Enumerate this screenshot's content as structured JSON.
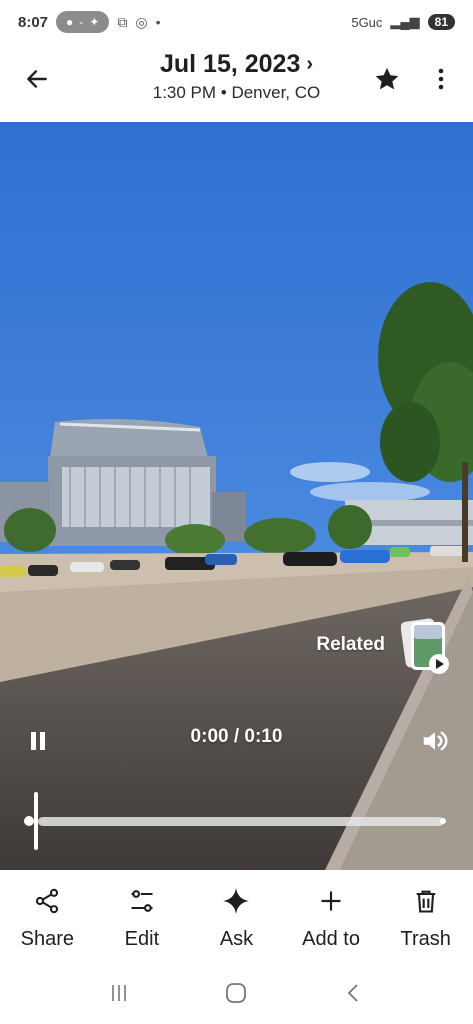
{
  "status_bar": {
    "time": "8:07",
    "network": "5Guc",
    "battery": "81"
  },
  "header": {
    "title": "Jul 15, 2023",
    "subtitle": "1:30 PM • Denver, CO"
  },
  "media": {
    "related_label": "Related",
    "current_time": "0:00",
    "duration": "0:10",
    "time_display": "0:00 / 0:10",
    "progress": 0
  },
  "actions": [
    {
      "label": "Share",
      "icon": "share-icon"
    },
    {
      "label": "Edit",
      "icon": "edit-sliders-icon"
    },
    {
      "label": "Ask",
      "icon": "sparkle-icon"
    },
    {
      "label": "Add to",
      "icon": "plus-icon"
    },
    {
      "label": "Trash",
      "icon": "trash-icon"
    }
  ],
  "colors": {
    "sky": "#3f7fd6",
    "white": "#ffffff",
    "text": "#1f1f1f"
  }
}
